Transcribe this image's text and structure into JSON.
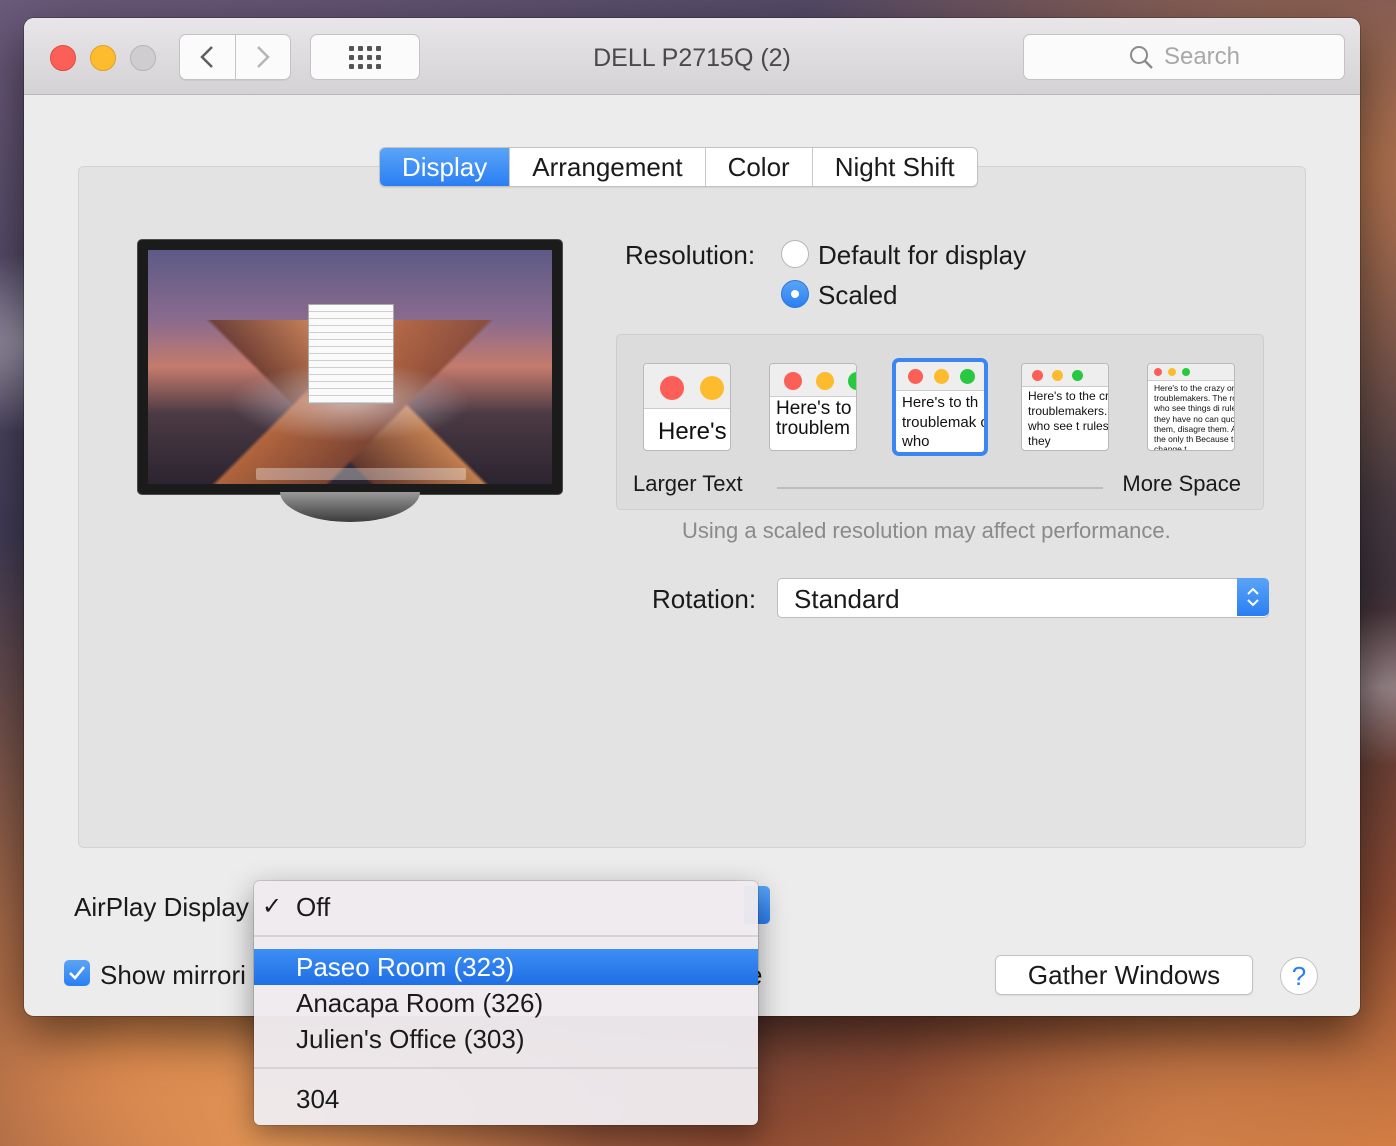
{
  "window": {
    "title": "DELL P2715Q (2)",
    "search_placeholder": "Search"
  },
  "tabs": [
    {
      "label": "Display",
      "active": true
    },
    {
      "label": "Arrangement",
      "active": false
    },
    {
      "label": "Color",
      "active": false
    },
    {
      "label": "Night Shift",
      "active": false
    }
  ],
  "resolution": {
    "label": "Resolution:",
    "options": [
      {
        "label": "Default for display",
        "selected": false
      },
      {
        "label": "Scaled",
        "selected": true
      }
    ],
    "scale_thumbs": [
      {
        "text": "Here's",
        "selected": false
      },
      {
        "text": "Here's to troublem",
        "selected": false
      },
      {
        "text": "Here's to th troublemak ones who",
        "selected": true
      },
      {
        "text": "Here's to the cr troublemakers. ones who see t rules. And they",
        "selected": false
      },
      {
        "text": "Here's to the crazy one troublemakers. The rou ones who see things di rules. And they have no can quote them, disagre them. About the only th Because they change t",
        "selected": false
      }
    ],
    "larger_text": "Larger Text",
    "more_space": "More Space",
    "hint": "Using a scaled resolution may affect performance."
  },
  "rotation": {
    "label": "Rotation:",
    "value": "Standard"
  },
  "airplay": {
    "label": "AirPlay Display",
    "menu": {
      "selected": "Off",
      "items_group1": [
        "Paseo Room (323)",
        "Anacapa Room (326)",
        "Julien's Office (303)"
      ],
      "highlighted": "Paseo Room (323)",
      "items_group2": [
        "304"
      ]
    }
  },
  "mirroring": {
    "label": "Show mirrori",
    "trailing": "e",
    "checked": true
  },
  "buttons": {
    "gather": "Gather Windows",
    "help": "?"
  },
  "colors": {
    "accent": "#2a7ff2",
    "close": "#fc5f57",
    "minimize": "#fdbc2e",
    "zoom_disabled": "#cfcdcf"
  }
}
